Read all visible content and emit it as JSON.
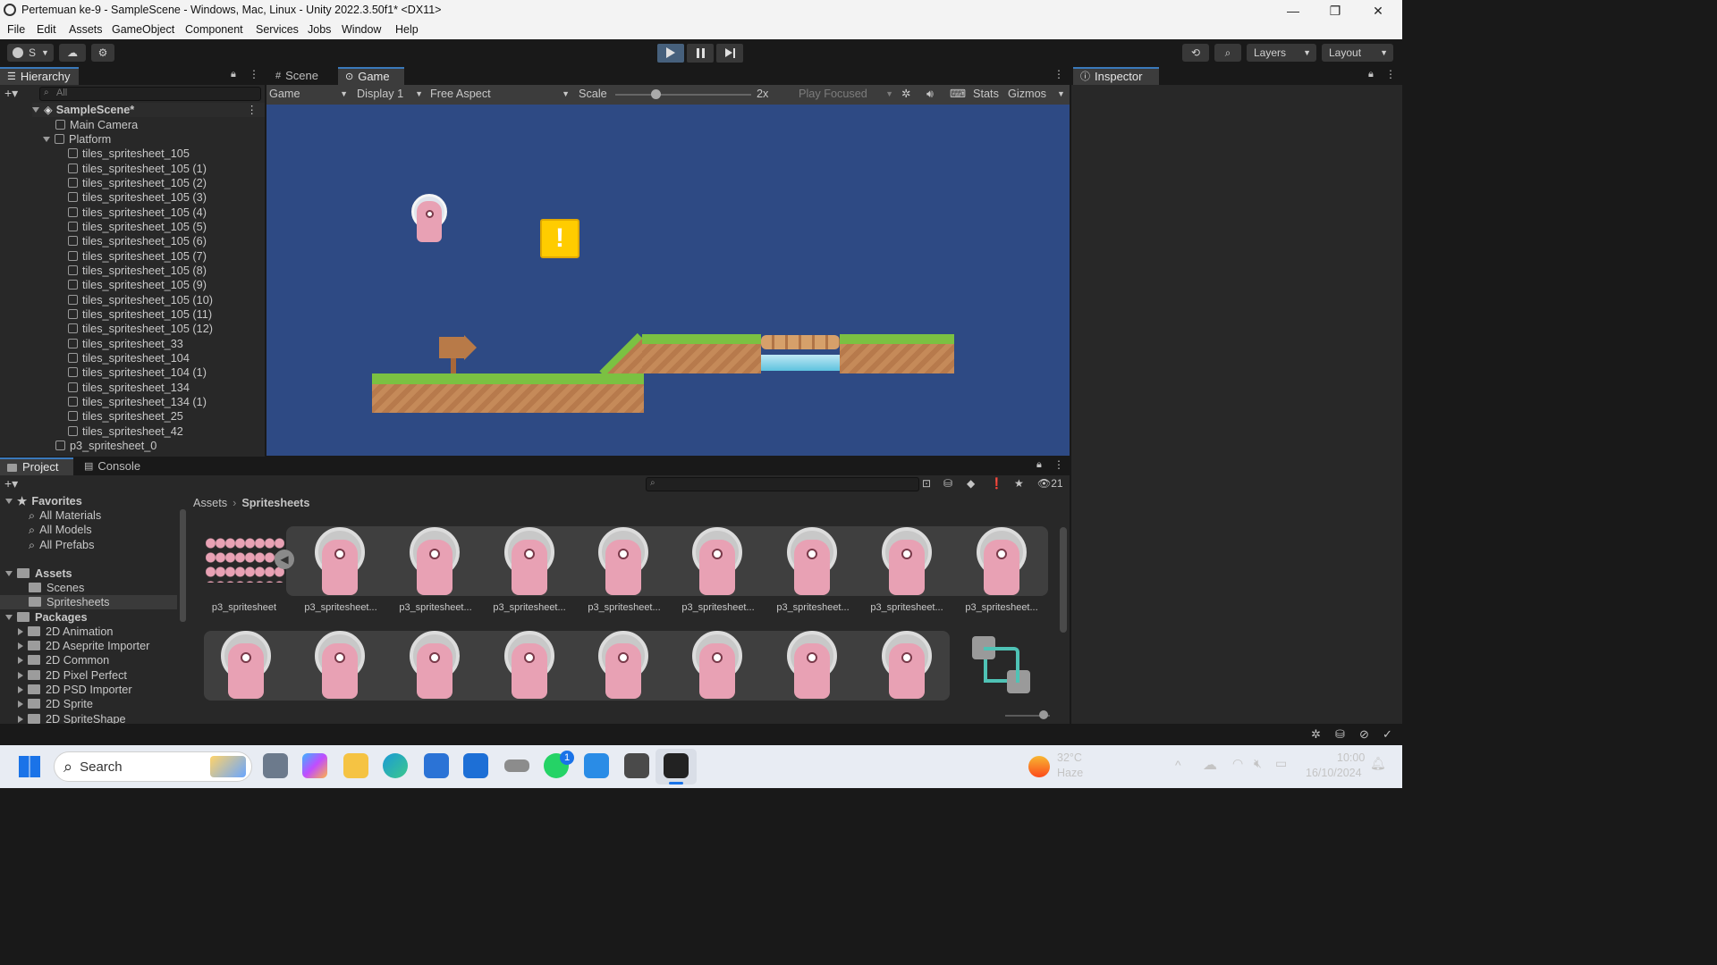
{
  "window": {
    "title": "Pertemuan ke-9 - SampleScene - Windows, Mac, Linux - Unity 2022.3.50f1* <DX11>",
    "minimize": "—",
    "restore": "❐",
    "close": "✕"
  },
  "menu": [
    "File",
    "Edit",
    "Assets",
    "GameObject",
    "Component",
    "Services",
    "Jobs",
    "Window",
    "Help"
  ],
  "toolbar": {
    "account": "S",
    "layers": "Layers",
    "layout": "Layout"
  },
  "hierarchy": {
    "tab": "Hierarchy",
    "search_placeholder": "All",
    "scene": "SampleScene*",
    "items": [
      "Main Camera",
      "Platform",
      "tiles_spritesheet_105",
      "tiles_spritesheet_105 (1)",
      "tiles_spritesheet_105 (2)",
      "tiles_spritesheet_105 (3)",
      "tiles_spritesheet_105 (4)",
      "tiles_spritesheet_105 (5)",
      "tiles_spritesheet_105 (6)",
      "tiles_spritesheet_105 (7)",
      "tiles_spritesheet_105 (8)",
      "tiles_spritesheet_105 (9)",
      "tiles_spritesheet_105 (10)",
      "tiles_spritesheet_105 (11)",
      "tiles_spritesheet_105 (12)",
      "tiles_spritesheet_33",
      "tiles_spritesheet_104",
      "tiles_spritesheet_104 (1)",
      "tiles_spritesheet_134",
      "tiles_spritesheet_134 (1)",
      "tiles_spritesheet_25",
      "tiles_spritesheet_42",
      "p3_spritesheet_0"
    ]
  },
  "game": {
    "tab_scene": "Scene",
    "tab_game": "Game",
    "mode": "Game",
    "display": "Display 1",
    "aspect": "Free Aspect",
    "scale_label": "Scale",
    "scale_value": "2x",
    "play_focused": "Play Focused",
    "stats": "Stats",
    "gizmos": "Gizmos"
  },
  "inspector": {
    "tab": "Inspector"
  },
  "project": {
    "tab_project": "Project",
    "tab_console": "Console",
    "hidden_count": "21",
    "breadcrumb": [
      "Assets",
      "Sprites​heets"
    ],
    "favorites_label": "Favorites",
    "favorites": [
      "All Materials",
      "All Models",
      "All Prefabs"
    ],
    "assets_label": "Assets",
    "assets": [
      "Scenes",
      "Spritesheets"
    ],
    "packages_label": "Packages",
    "packages": [
      "2D Animation",
      "2D Aseprite Importer",
      "2D Common",
      "2D Pixel Perfect",
      "2D PSD Importer",
      "2D Sprite",
      "2D SpriteShape"
    ],
    "grid_labels": [
      "p3_spritesheet",
      "p3_spritesheet...",
      "p3_spritesheet...",
      "p3_spritesheet...",
      "p3_spritesheet...",
      "p3_spritesheet...",
      "p3_spritesheet...",
      "p3_spritesheet...",
      "p3_spritesheet..."
    ]
  },
  "taskbar": {
    "search": "Search",
    "weather_temp": "32°C",
    "weather_desc": "Haze",
    "time": "10:00",
    "date": "16/10/2024",
    "whatsapp_badge": "1"
  },
  "colors": {
    "game_bg": "#2e4a84",
    "grass": "#7bc142",
    "dirt": "#c58a59",
    "alien": "#e8a1b4",
    "accent": "#3a79bb"
  }
}
